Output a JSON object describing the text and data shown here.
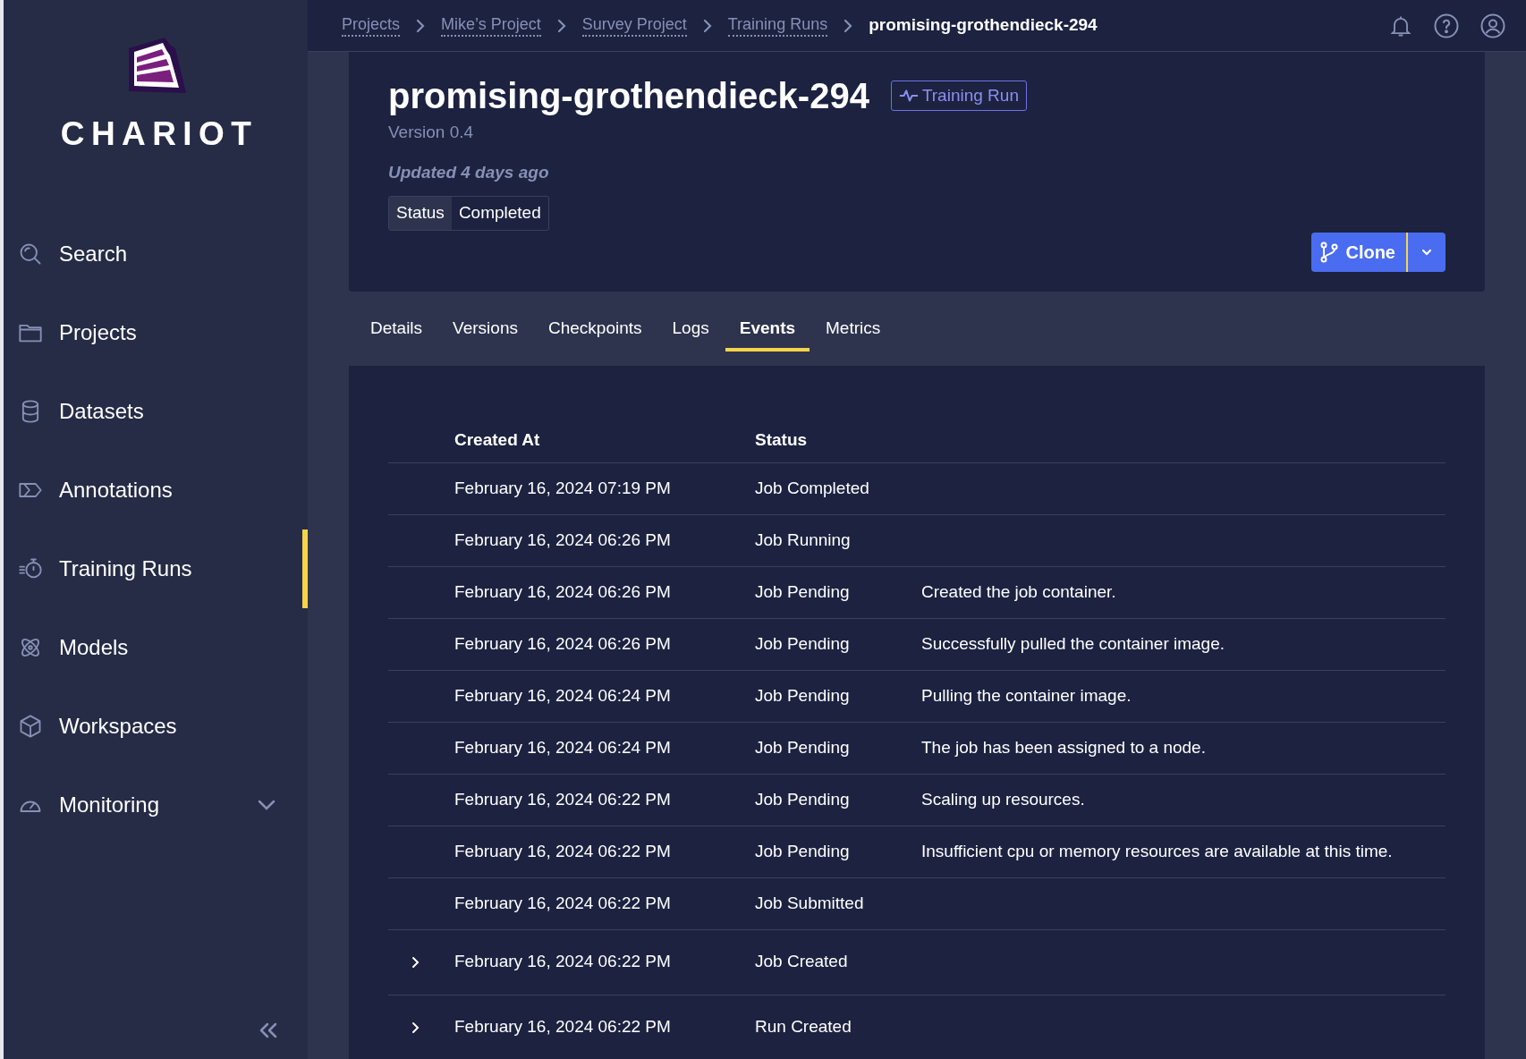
{
  "sidebar": {
    "logo_text": "CHARIOT",
    "items": [
      {
        "label": "Search",
        "selected": false,
        "expandable": false
      },
      {
        "label": "Projects",
        "selected": false,
        "expandable": false
      },
      {
        "label": "Datasets",
        "selected": false,
        "expandable": false
      },
      {
        "label": "Annotations",
        "selected": false,
        "expandable": false
      },
      {
        "label": "Training Runs",
        "selected": true,
        "expandable": false
      },
      {
        "label": "Models",
        "selected": false,
        "expandable": false
      },
      {
        "label": "Workspaces",
        "selected": false,
        "expandable": false
      },
      {
        "label": "Monitoring",
        "selected": false,
        "expandable": true
      }
    ]
  },
  "breadcrumbs": [
    {
      "label": "Projects",
      "current": false
    },
    {
      "label": "Mike’s Project",
      "current": false
    },
    {
      "label": "Survey Project",
      "current": false
    },
    {
      "label": "Training Runs",
      "current": false
    },
    {
      "label": "promising-grothendieck-294",
      "current": true
    }
  ],
  "header": {
    "title": "promising-grothendieck-294",
    "type_badge": "Training Run",
    "version": "Version 0.4",
    "updated": "Updated 4 days ago",
    "status_label": "Status",
    "status_value": "Completed",
    "clone_button": "Clone"
  },
  "tabs": [
    {
      "label": "Details",
      "selected": false
    },
    {
      "label": "Versions",
      "selected": false
    },
    {
      "label": "Checkpoints",
      "selected": false
    },
    {
      "label": "Logs",
      "selected": false
    },
    {
      "label": "Events",
      "selected": true
    },
    {
      "label": "Metrics",
      "selected": false
    }
  ],
  "table": {
    "columns": [
      "Created At",
      "Status"
    ],
    "rows": [
      {
        "created_at": "February 16, 2024 07:19 PM",
        "status": "Job Completed",
        "expandable": false
      },
      {
        "created_at": "February 16, 2024 06:26 PM",
        "status": "Job Running",
        "expandable": false
      },
      {
        "created_at": "February 16, 2024 06:26 PM",
        "status": "Job Pending",
        "message": "Created the job container.",
        "expandable": false
      },
      {
        "created_at": "February 16, 2024 06:26 PM",
        "status": "Job Pending",
        "message": "Successfully pulled the container image.",
        "expandable": false
      },
      {
        "created_at": "February 16, 2024 06:24 PM",
        "status": "Job Pending",
        "message": "Pulling the container image.",
        "expandable": false
      },
      {
        "created_at": "February 16, 2024 06:24 PM",
        "status": "Job Pending",
        "message": "The job has been assigned to a node.",
        "expandable": false
      },
      {
        "created_at": "February 16, 2024 06:22 PM",
        "status": "Job Pending",
        "message": "Scaling up resources.",
        "expandable": false
      },
      {
        "created_at": "February 16, 2024 06:22 PM",
        "status": "Job Pending",
        "message": "Insufficient cpu or memory resources are available at this time.",
        "expandable": false
      },
      {
        "created_at": "February 16, 2024 06:22 PM",
        "status": "Job Submitted",
        "expandable": false
      },
      {
        "created_at": "February 16, 2024 06:22 PM",
        "status": "Job Created",
        "expandable": true
      },
      {
        "created_at": "February 16, 2024 06:22 PM",
        "status": "Run Created",
        "expandable": true
      }
    ]
  }
}
